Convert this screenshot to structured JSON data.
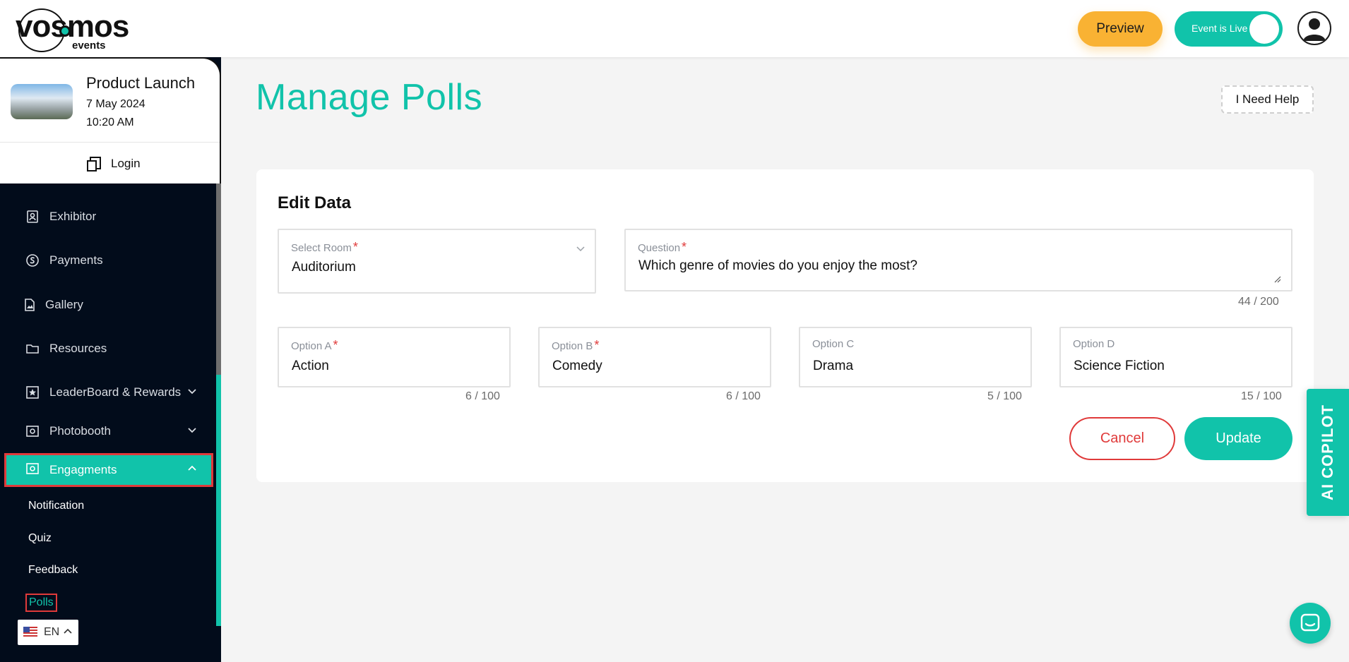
{
  "brand": {
    "name": "vosmos",
    "sub": "events",
    "accent": "#11c3aa"
  },
  "header": {
    "preview_label": "Preview",
    "live_label": "Event is Live"
  },
  "event": {
    "name": "Product Launch",
    "date": "7 May 2024",
    "time": "10:20 AM",
    "login_label": "Login"
  },
  "sidebar": {
    "items": [
      {
        "label": "Exhibitor",
        "icon": "badge-icon"
      },
      {
        "label": "Payments",
        "icon": "payments-icon"
      },
      {
        "label": "Gallery",
        "icon": "gallery-icon"
      },
      {
        "label": "Resources",
        "icon": "folder-icon"
      },
      {
        "label": "LeaderBoard & Rewards",
        "icon": "star-icon"
      },
      {
        "label": "Photobooth",
        "icon": "camera-icon"
      },
      {
        "label": "Engagments",
        "icon": "engagement-icon"
      }
    ],
    "sub_items": [
      {
        "label": "Notification"
      },
      {
        "label": "Quiz"
      },
      {
        "label": "Feedback"
      },
      {
        "label": "Polls"
      }
    ]
  },
  "language": {
    "code": "EN"
  },
  "page": {
    "title": "Manage Polls",
    "help_label": "I Need Help"
  },
  "form": {
    "title": "Edit Data",
    "room": {
      "label": "Select Room",
      "value": "Auditorium"
    },
    "question": {
      "label": "Question",
      "value": "Which genre of movies do you enjoy the most?",
      "counter": "44 / 200"
    },
    "option_a": {
      "label": "Option A",
      "value": "Action",
      "counter": "6 / 100"
    },
    "option_b": {
      "label": "Option B",
      "value": "Comedy",
      "counter": "6 / 100"
    },
    "option_c": {
      "label": "Option C",
      "value": "Drama",
      "counter": "5 / 100"
    },
    "option_d": {
      "label": "Option D",
      "value": "Science Fiction",
      "counter": "15 / 100"
    },
    "cancel_label": "Cancel",
    "update_label": "Update"
  },
  "copilot": {
    "label": "AI COPILOT"
  }
}
